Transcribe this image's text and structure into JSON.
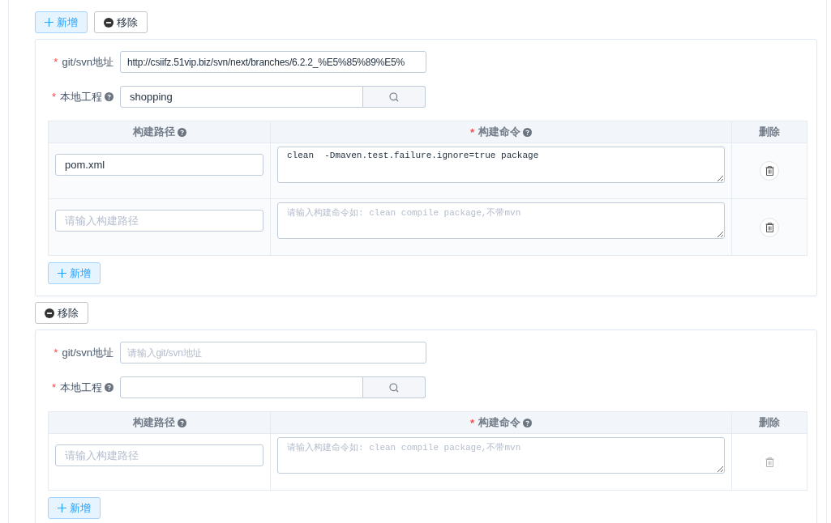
{
  "repos": [
    {
      "actions": [
        {
          "kind": "add",
          "label": "新增"
        },
        {
          "kind": "remove",
          "label": "移除"
        }
      ],
      "url_field": {
        "mark": "*",
        "label": "git/svn地址",
        "value": "http://csiifz.51vip.biz/svn/next/branches/6.2.2_%E5%85%89%E5%"
      },
      "project_field": {
        "mark": "*",
        "label": "本地工程",
        "help": true,
        "value": "shopping"
      },
      "table": {
        "columns": [
          {
            "label": "构建路径",
            "help": true
          },
          {
            "mark": "*",
            "label": "构建命令",
            "help": true
          },
          {
            "label": "删除",
            "help": false
          }
        ],
        "rows": [
          {
            "path": {
              "value": "pom.xml"
            },
            "command": {
              "value": "clean  -Dmaven.test.failure.ignore=true package"
            },
            "delete_disabled": false
          },
          {
            "path": {
              "placeholder": "请输入构建路径"
            },
            "command": {
              "placeholder": "请输入构建命令如: clean compile package,不带mvn"
            },
            "delete_disabled": false
          }
        ]
      },
      "add_button": "新增"
    },
    {
      "actions": [
        {
          "kind": "remove",
          "label": "移除"
        }
      ],
      "url_field": {
        "mark": "*",
        "label": "git/svn地址",
        "placeholder": "请输入git/svn地址"
      },
      "project_field": {
        "mark": "*",
        "label": "本地工程",
        "help": true
      },
      "table": {
        "columns": [
          {
            "label": "构建路径",
            "help": true
          },
          {
            "mark": "*",
            "label": "构建命令",
            "help": true
          },
          {
            "label": "删除",
            "help": false
          }
        ],
        "rows": [
          {
            "path": {
              "placeholder": "请输入构建路径"
            },
            "command": {
              "placeholder": "请输入构建命令如: clean compile package,不带mvn"
            },
            "delete_disabled": true
          }
        ]
      },
      "add_button": "新增"
    }
  ]
}
